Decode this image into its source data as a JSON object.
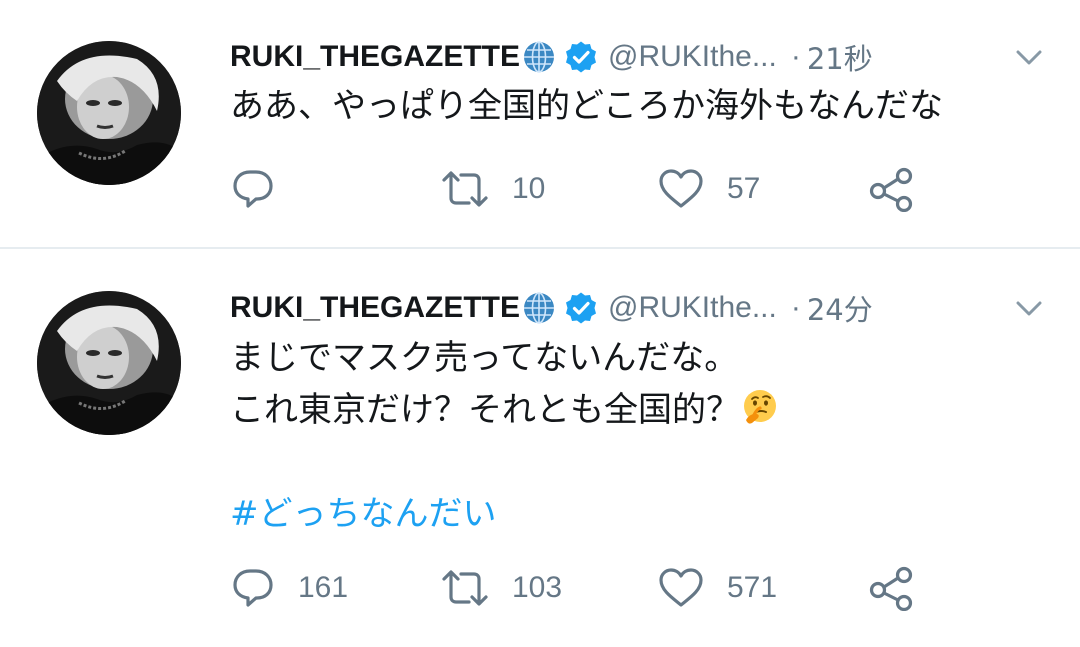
{
  "tweets": [
    {
      "display_name": "RUKI_THEGAZETTE",
      "handle": "@RUKIthe...",
      "timestamp": "21秒",
      "text_lines": [
        "ああ、やっぱり全国的どころか海外もなんだな"
      ],
      "hashtag": "",
      "reply_count": "",
      "retweet_count": "10",
      "like_count": "57"
    },
    {
      "display_name": "RUKI_THEGAZETTE",
      "handle": "@RUKIthe...",
      "timestamp": "24分",
      "text_lines": [
        "まじでマスク売ってないんだな。",
        "これ東京だけ？それとも全国的？"
      ],
      "hashtag": "#どっちなんだい",
      "reply_count": "161",
      "retweet_count": "103",
      "like_count": "571"
    }
  ],
  "icons": {
    "verified": "verified-badge-icon",
    "globe": "globe-emoji",
    "thinking": "thinking-face-emoji",
    "reply": "reply-icon",
    "retweet": "retweet-icon",
    "like": "heart-icon",
    "share": "share-icon",
    "caret": "chevron-down-icon"
  },
  "colors": {
    "text": "#14171a",
    "secondary": "#657786",
    "accent": "#1da1f2",
    "divider": "#e6ecf0"
  }
}
